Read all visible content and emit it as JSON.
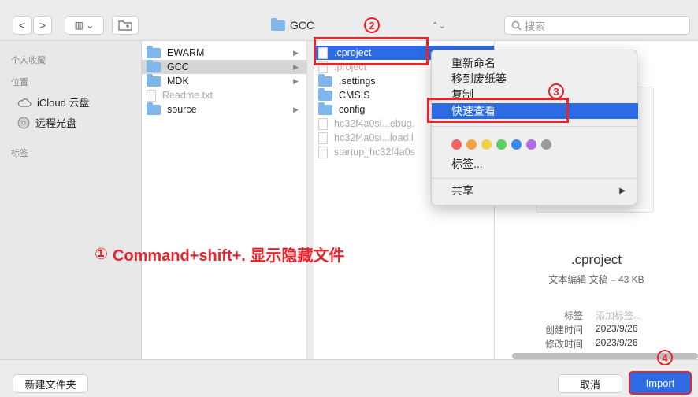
{
  "toolbar": {
    "back": "<",
    "forward": ">",
    "view_mode": "▥ ⌄",
    "new_folder_icon": "folder-plus-icon",
    "path": "GCC",
    "path_chevron": "⌃⌄",
    "search_placeholder": "搜索"
  },
  "sidebar": {
    "favorites": "个人收藏",
    "locations": "位置",
    "icloud": "iCloud 云盘",
    "optical": "远程光盘",
    "tags": "标签"
  },
  "column1": [
    {
      "name": "EWARM",
      "type": "folder",
      "arrow": "▶"
    },
    {
      "name": "GCC",
      "type": "folder",
      "arrow": "▶"
    },
    {
      "name": "MDK",
      "type": "folder",
      "arrow": "▶"
    },
    {
      "name": "Readme.txt",
      "type": "file",
      "arrow": ""
    },
    {
      "name": "source",
      "type": "folder",
      "arrow": "▶"
    }
  ],
  "column2": [
    {
      "name": ".cproject",
      "type": "file"
    },
    {
      "name": ".project",
      "type": "file"
    },
    {
      "name": ".settings",
      "type": "folder"
    },
    {
      "name": "CMSIS",
      "type": "folder"
    },
    {
      "name": "config",
      "type": "folder"
    },
    {
      "name": "hc32f4a0si...ebug.",
      "type": "file"
    },
    {
      "name": "hc32f4a0si...load.l",
      "type": "file"
    },
    {
      "name": "startup_hc32f4a0s",
      "type": "file"
    }
  ],
  "context_menu": {
    "rename": "重新命名",
    "trash": "移到废纸篓",
    "copy": "复制",
    "quicklook": "快速查看",
    "tags": "标签...",
    "share": "共享",
    "share_arrow": "▶",
    "tag_colors": [
      "#f26560",
      "#f4a343",
      "#f2d148",
      "#5fcf5f",
      "#3c8bf0",
      "#b06ee0",
      "#9a9a9a"
    ]
  },
  "preview": {
    "name": ".cproject",
    "subtitle": "文本编辑 文稿 – 43 KB",
    "tags_label": "标签",
    "tags_value": "添加标签...",
    "created_label": "创建时间",
    "created_value": "2023/9/26",
    "modified_label": "修改时间",
    "modified_value": "2023/9/26"
  },
  "bottom": {
    "new_folder": "新建文件夹",
    "cancel": "取消",
    "import": "Import"
  },
  "annotations": {
    "one": "①",
    "one_text": "Command+shift+. 显示隐藏文件",
    "two": "2",
    "three": "3",
    "four": "4"
  },
  "accent": "#2d6be4",
  "annotation_color": "#e8242b"
}
